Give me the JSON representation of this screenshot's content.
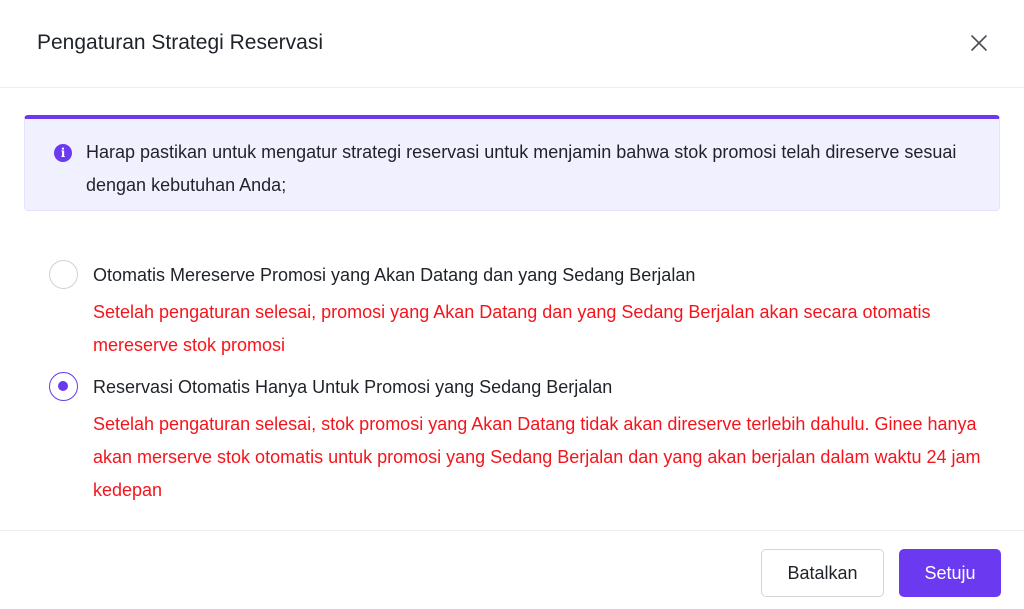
{
  "dialog": {
    "title": "Pengaturan Strategi Reservasi",
    "close_icon": "close-icon"
  },
  "alert": {
    "icon": "info-icon",
    "icon_glyph": "i",
    "text": "Harap pastikan untuk mengatur strategi reservasi untuk menjamin bahwa stok promosi telah direserve sesuai dengan kebutuhan Anda;"
  },
  "options": [
    {
      "label": "Otomatis Mereserve Promosi yang Akan Datang dan yang Sedang Berjalan",
      "description": "Setelah pengaturan selesai, promosi yang Akan Datang dan yang Sedang Berjalan akan secara otomatis mereserve stok promosi",
      "selected": false
    },
    {
      "label": "Reservasi Otomatis Hanya Untuk Promosi yang Sedang Berjalan",
      "description": "Setelah pengaturan selesai, stok promosi yang Akan Datang tidak akan direserve terlebih dahulu. Ginee hanya akan merserve stok otomatis untuk promosi yang Sedang Berjalan dan yang akan berjalan dalam waktu 24 jam kedepan",
      "selected": true
    }
  ],
  "footer": {
    "cancel_label": "Batalkan",
    "confirm_label": "Setuju"
  },
  "colors": {
    "accent": "#6b3af0",
    "warning_text": "#f5141c",
    "alert_background": "#f1f0ff"
  }
}
